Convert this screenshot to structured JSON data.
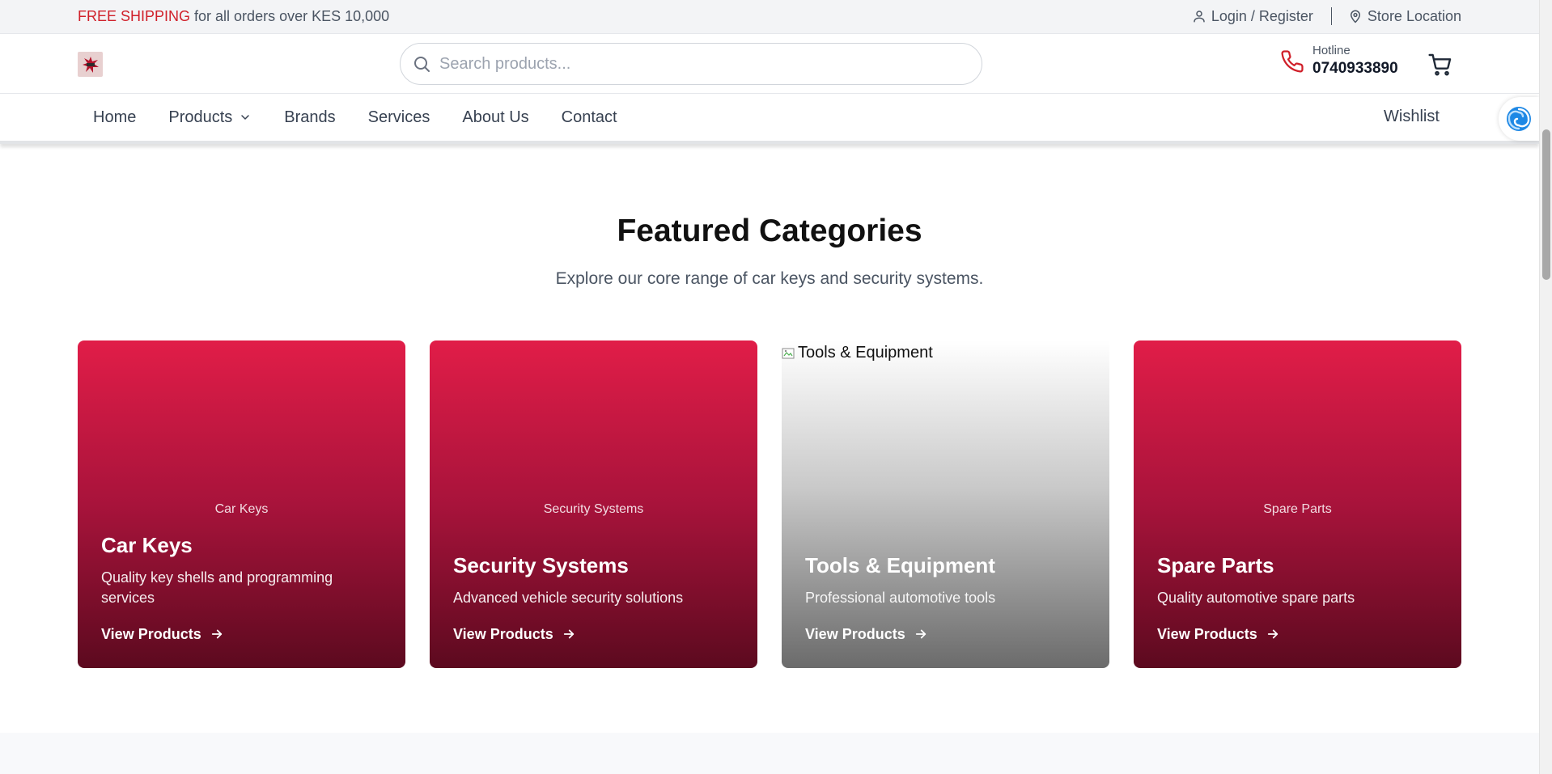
{
  "topbar": {
    "promo_accent": "FREE SHIPPING",
    "promo_rest": " for all orders over KES 10,000",
    "login_label": "Login / Register",
    "store_label": "Store Location"
  },
  "header": {
    "search_placeholder": "Search products...",
    "hotline_label": "Hotline",
    "hotline_number": "0740933890"
  },
  "nav": {
    "items": [
      "Home",
      "Products",
      "Brands",
      "Services",
      "About Us",
      "Contact"
    ],
    "wishlist": "Wishlist"
  },
  "section": {
    "title": "Featured Categories",
    "subtitle": "Explore our core range of car keys and security systems."
  },
  "cards": [
    {
      "alt": "Car Keys",
      "name": "Car Keys",
      "desc": "Quality key shells and programming services",
      "cta": "View Products"
    },
    {
      "alt": "Security Systems",
      "name": "Security Systems",
      "desc": "Advanced vehicle security solutions",
      "cta": "View Products"
    },
    {
      "alt": "Tools & Equipment",
      "name": "Tools & Equipment",
      "desc": "Professional automotive tools",
      "cta": "View Products"
    },
    {
      "alt": "Spare Parts",
      "name": "Spare Parts",
      "desc": "Quality automotive spare parts",
      "cta": "View Products"
    }
  ],
  "colors": {
    "accent": "#d0202a",
    "card_top": "#e11d48",
    "card_bottom": "#5c0a1f"
  },
  "icons": {
    "login": "user-icon",
    "store": "map-pin-icon",
    "search": "search-icon",
    "hotline": "phone-icon",
    "cart": "cart-icon",
    "products_menu": "chevron-down-icon",
    "cta": "arrow-right-icon",
    "assistant": "assistant-swirl-icon"
  }
}
